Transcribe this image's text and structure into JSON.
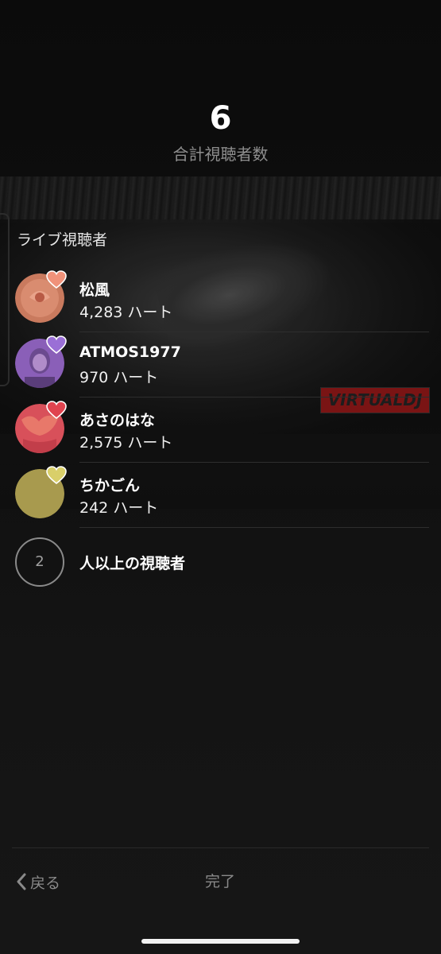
{
  "header": {
    "total_count": "6",
    "total_label": "合計視聴者数"
  },
  "section": {
    "label": "ライブ視聴者"
  },
  "viewers": [
    {
      "name": "松風",
      "hearts": "4,283 ハート",
      "avatar_color": "#c97a5e",
      "heart_color": "#f0927a"
    },
    {
      "name": "ATMOS1977",
      "hearts": "970 ハート",
      "avatar_color": "#8a5fb8",
      "heart_color": "#9a6fd6"
    },
    {
      "name": "あさのはな",
      "hearts": "2,575 ハート",
      "avatar_color": "#d8505a",
      "heart_color": "#e0434f"
    },
    {
      "name": "ちかごん",
      "hearts": "242 ハート",
      "avatar_color": "#a89a4e",
      "heart_color": "#d9cf6a"
    }
  ],
  "more_viewers": {
    "count": "2",
    "label": "人以上の視聴者"
  },
  "watermark": {
    "text": "VIRTUALDJ"
  },
  "footer": {
    "back_label": "戻る",
    "done_label": "完了"
  }
}
